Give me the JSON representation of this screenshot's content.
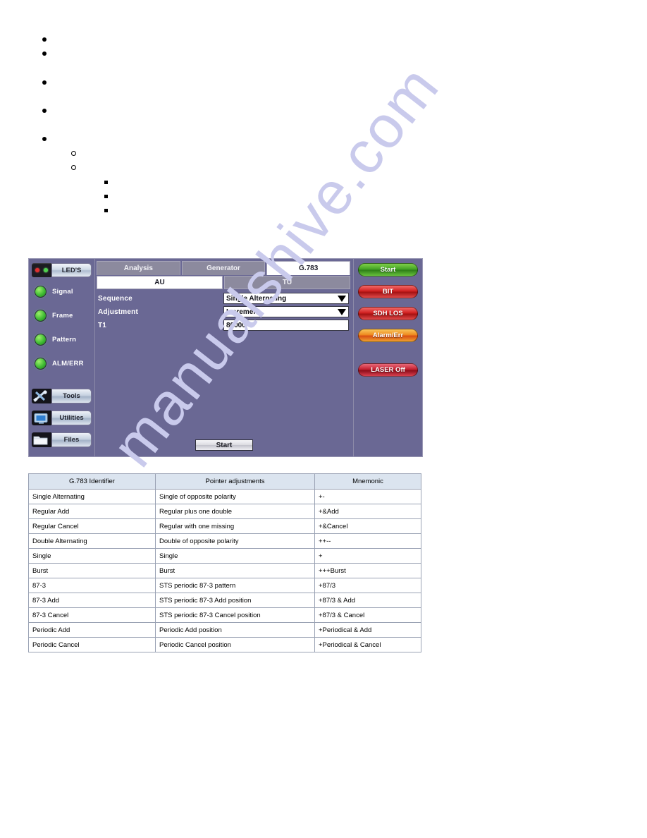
{
  "watermark": {
    "text": "manualshive.com"
  },
  "outline": {
    "items": [
      {
        "level": 1,
        "marker": "disc",
        "text": ""
      },
      {
        "level": 1,
        "marker": "disc",
        "text": ""
      },
      {
        "level": 1,
        "marker": "disc",
        "text": ""
      },
      {
        "level": 1,
        "marker": "disc",
        "text": ""
      },
      {
        "level": 1,
        "marker": "disc",
        "text": ""
      },
      {
        "level": 2,
        "marker": "circle",
        "text": ""
      },
      {
        "level": 2,
        "marker": "circle",
        "text": ""
      },
      {
        "level": 3,
        "marker": "square",
        "text": ""
      },
      {
        "level": 3,
        "marker": "square",
        "text": ""
      },
      {
        "level": 3,
        "marker": "square",
        "text": ""
      }
    ]
  },
  "device": {
    "left_rail": {
      "leds_button_label": "LED'S",
      "status_leds": [
        {
          "label": "Signal",
          "color": "#3fbb33"
        },
        {
          "label": "Frame",
          "color": "#3fbb33"
        },
        {
          "label": "Pattern",
          "color": "#3fbb33"
        },
        {
          "label": "ALM/ERR",
          "color": "#3fbb33"
        }
      ],
      "buttons": [
        {
          "label": "Tools",
          "icon": "tools-icon"
        },
        {
          "label": "Utilities",
          "icon": "monitor-icon"
        },
        {
          "label": "Files",
          "icon": "folder-icon"
        }
      ]
    },
    "tabs": [
      {
        "label": "Analysis",
        "active": false
      },
      {
        "label": "Generator",
        "active": false
      },
      {
        "label": "G.783",
        "active": true
      }
    ],
    "subtabs": [
      {
        "label": "AU",
        "active": true
      },
      {
        "label": "TU",
        "active": false
      }
    ],
    "form": {
      "rows": [
        {
          "label": "Sequence",
          "value": "Single Alternating",
          "type": "dropdown"
        },
        {
          "label": "Adjustment",
          "value": "Increment",
          "type": "dropdown"
        },
        {
          "label": "T1",
          "value": "80000",
          "type": "text"
        }
      ]
    },
    "bottom_button": {
      "label": "Start"
    },
    "right_rail": {
      "buttons": [
        {
          "label": "Start",
          "color": "#3f9f22",
          "style": "green"
        },
        {
          "label": "BIT",
          "color": "#d12020",
          "style": "red"
        },
        {
          "label": "SDH LOS",
          "color": "#d12020",
          "style": "red"
        },
        {
          "label": "Alarm/Err",
          "color": "#ef8a20",
          "style": "amber"
        },
        {
          "label": "LASER Off",
          "color": "#c41f2f",
          "style": "laser"
        }
      ]
    }
  },
  "table": {
    "headers": [
      "G.783 Identifier",
      "Pointer adjustments",
      "Mnemonic"
    ],
    "rows": [
      [
        "Single Alternating",
        "Single of opposite polarity",
        "+-"
      ],
      [
        "Regular Add",
        "Regular plus one double",
        "+&Add"
      ],
      [
        "Regular Cancel",
        "Regular with one missing",
        "+&Cancel"
      ],
      [
        "Double Alternating",
        "Double of opposite polarity",
        "++--"
      ],
      [
        "Single",
        "Single",
        "+"
      ],
      [
        "Burst",
        "Burst",
        "+++Burst"
      ],
      [
        "87-3",
        "STS periodic 87-3 pattern",
        "+87/3"
      ],
      [
        "87-3 Add",
        "STS periodic 87-3 Add position",
        "+87/3 & Add"
      ],
      [
        "87-3 Cancel",
        "STS periodic 87-3 Cancel position",
        "+87/3 & Cancel"
      ],
      [
        "Periodic Add",
        "Periodic Add position",
        "+Periodical & Add"
      ],
      [
        "Periodic Cancel",
        "Periodic Cancel position",
        "+Periodical & Cancel"
      ]
    ]
  }
}
